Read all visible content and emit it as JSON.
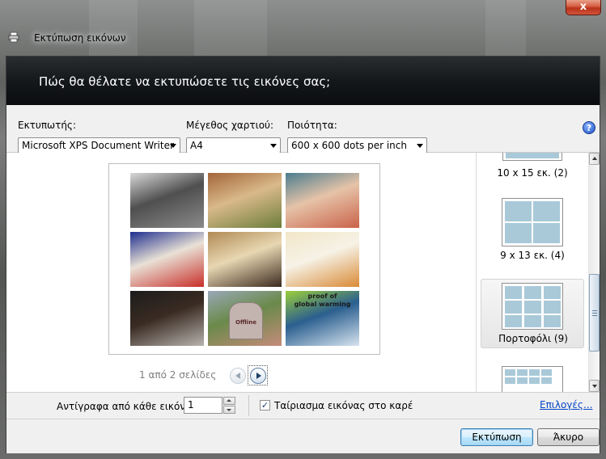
{
  "window": {
    "title": "Εκτύπωση εικόνων",
    "close_glyph": "x"
  },
  "header": {
    "question": "Πώς θα θέλατε να εκτυπώσετε τις εικόνες σας;"
  },
  "settings": {
    "printer_label": "Εκτυπωτής:",
    "printer_value": "Microsoft XPS Document Writer",
    "paper_label": "Μέγεθος χαρτιού:",
    "paper_value": "A4",
    "quality_label": "Ποιότητα:",
    "quality_value": "600 x 600 dots per inch",
    "help_glyph": "?"
  },
  "preview": {
    "page_info": "1 από 2 σελίδες",
    "photos": [
      {
        "name": "horse-photo",
        "colors": [
          "#d8d8d8",
          "#8a8a8a",
          "#4f4f4f"
        ]
      },
      {
        "name": "giraffe-photo",
        "colors": [
          "#a3653a",
          "#6c7d3a",
          "#d9b98a"
        ]
      },
      {
        "name": "couple-photo",
        "colors": [
          "#4a7d8f",
          "#c9634a",
          "#e6c3a8"
        ]
      },
      {
        "name": "cartoon-photo",
        "colors": [
          "#1f2f8f",
          "#c8302a",
          "#e9e1d6"
        ]
      },
      {
        "name": "sperm-egg-photo",
        "colors": [
          "#b08a55",
          "#3b2a1e",
          "#e8d7b2"
        ]
      },
      {
        "name": "cat-photo",
        "colors": [
          "#f2e6c8",
          "#d98a36",
          "#f6f2e6"
        ]
      },
      {
        "name": "smoke-photo",
        "colors": [
          "#1c1c1c",
          "#b7b3ae",
          "#3a2b22"
        ]
      },
      {
        "name": "offline-tomb-photo",
        "colors": [
          "#9aa8b8",
          "#c58b7a",
          "#6a8a4a"
        ]
      },
      {
        "name": "global-warming-photo",
        "colors": [
          "#9ccf3a",
          "#d7e4ef",
          "#2b5f8f"
        ]
      }
    ],
    "global_warming_text": [
      "proof of",
      "global warming"
    ],
    "offline_text": "Offline"
  },
  "layouts": [
    {
      "label": "10 x 15 εκ. (2)",
      "selected": false
    },
    {
      "label": "9 x 13 εκ. (4)",
      "selected": false
    },
    {
      "label": "Πορτοφόλι (9)",
      "selected": true
    },
    {
      "label": "",
      "selected": false
    }
  ],
  "options": {
    "copies_label": "Αντίγραφα από κάθε εικόνα:",
    "copies_value": "1",
    "fit_label": "Ταίριασμα εικόνας στο καρέ",
    "fit_checked": "✓",
    "options_link": "Επιλογές..."
  },
  "buttons": {
    "print": "Εκτύπωση",
    "cancel": "Άκυρο"
  }
}
